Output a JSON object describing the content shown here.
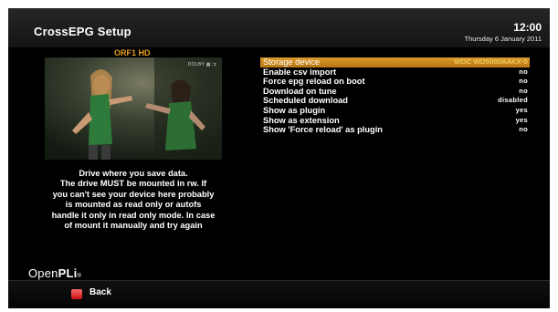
{
  "header": {
    "title": "CrossEPG Setup",
    "time": "12:00",
    "date": "Thursday 6 January 2011"
  },
  "preview": {
    "channel": "ORF1 HD",
    "info": "DOLBY ▦ ⇉"
  },
  "help_lines": [
    "Drive where you save data.",
    "The drive MUST be mounted in rw. If",
    "you can't see your device here probably",
    "is mounted as read only or autofs",
    "handle it only in read only mode. In case",
    "of mount it manually and try again"
  ],
  "settings": [
    {
      "label": "Storage device",
      "value": "WDC WD5000AAKX-0",
      "selected": true
    },
    {
      "label": "Enable csv import",
      "value": "no",
      "selected": false
    },
    {
      "label": "Force epg reload on boot",
      "value": "no",
      "selected": false
    },
    {
      "label": "Download on tune",
      "value": "no",
      "selected": false
    },
    {
      "label": "Scheduled download",
      "value": "disabled",
      "selected": false
    },
    {
      "label": "Show as plugin",
      "value": "yes",
      "selected": false
    },
    {
      "label": "Show as extension",
      "value": "yes",
      "selected": false
    },
    {
      "label": "Show 'Force reload' as plugin",
      "value": "no",
      "selected": false
    }
  ],
  "logo": {
    "open": "Open",
    "pli": "PLi",
    "mark": "®"
  },
  "footer": {
    "back_label": "Back"
  },
  "colors": {
    "selection": "#c8861e",
    "selected_value": "#ffe070",
    "channel": "#e8a020",
    "red_button": "#e02020"
  }
}
